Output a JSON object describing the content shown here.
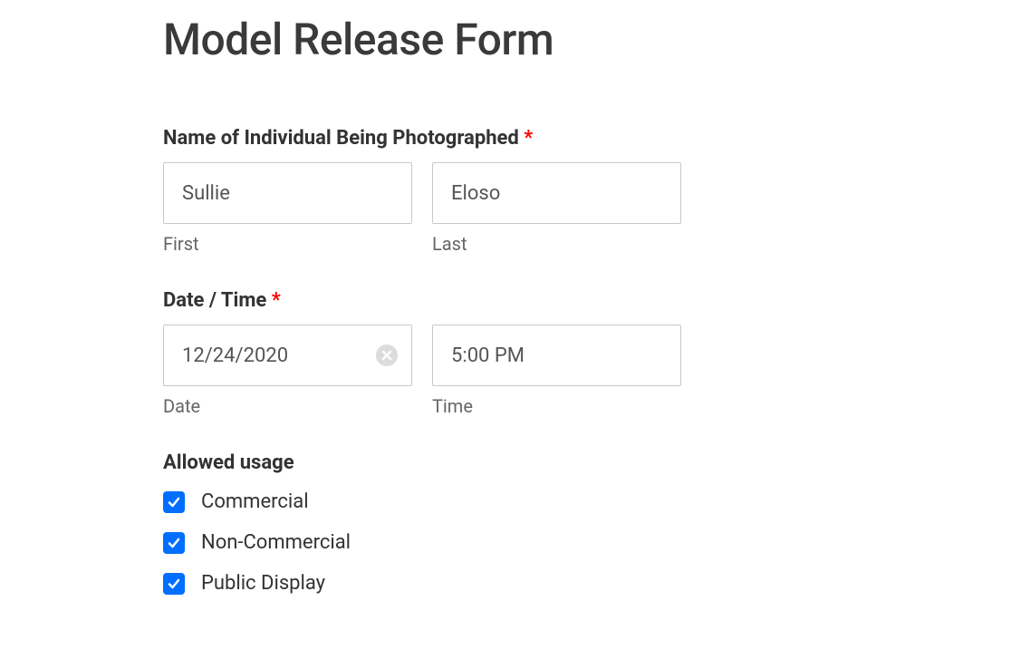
{
  "form": {
    "title": "Model Release Form",
    "name": {
      "label": "Name of Individual Being Photographed",
      "required_mark": "*",
      "first": {
        "value": "Sullie",
        "sublabel": "First"
      },
      "last": {
        "value": "Eloso",
        "sublabel": "Last"
      }
    },
    "datetime": {
      "label": "Date / Time",
      "required_mark": "*",
      "date": {
        "value": "12/24/2020",
        "sublabel": "Date"
      },
      "time": {
        "value": "5:00 PM",
        "sublabel": "Time"
      }
    },
    "allowed_usage": {
      "label": "Allowed usage",
      "options": [
        {
          "label": "Commercial"
        },
        {
          "label": "Non-Commercial"
        },
        {
          "label": "Public Display"
        }
      ]
    }
  }
}
